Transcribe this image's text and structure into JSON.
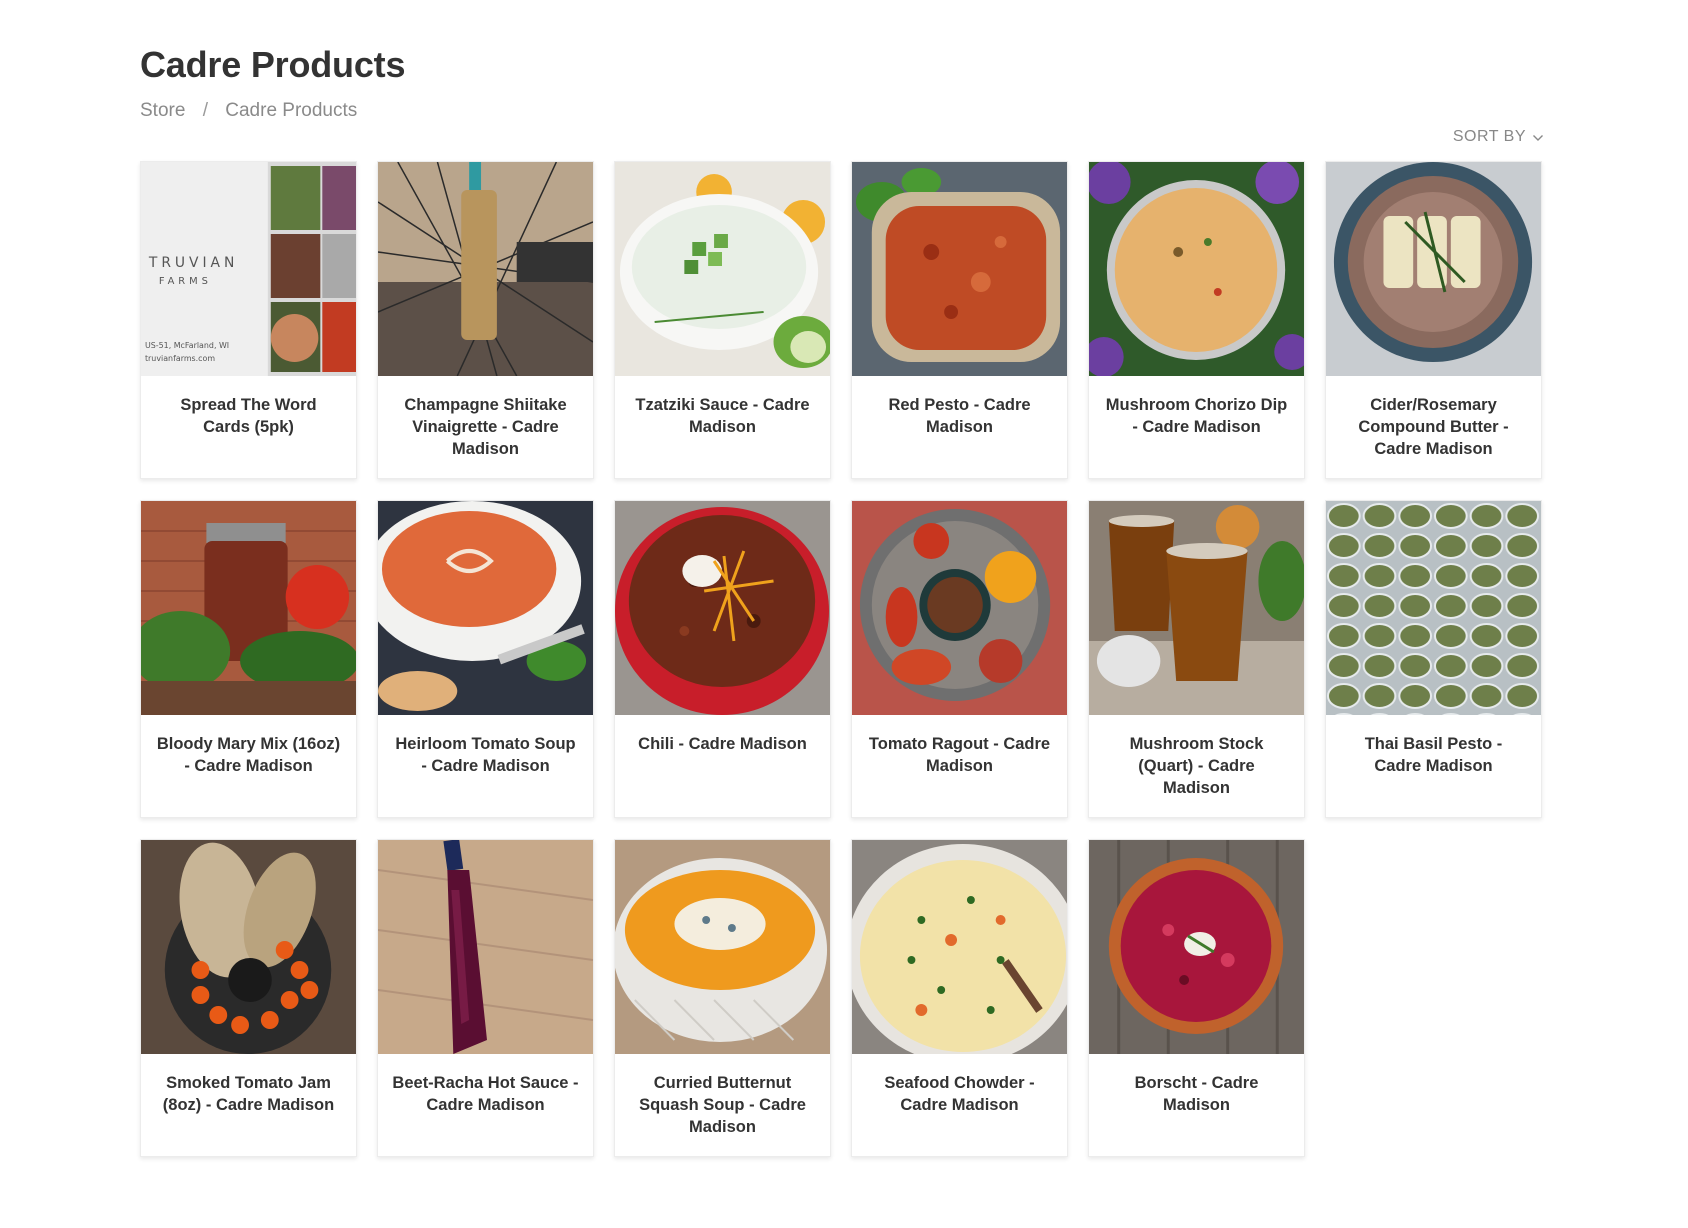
{
  "page": {
    "title": "Cadre Products",
    "breadcrumb": [
      {
        "label": "Store"
      },
      {
        "label": "Cadre Products"
      }
    ],
    "sort_label": "SORT BY"
  },
  "products": [
    {
      "name": "Spread The Word Cards (5pk)",
      "image_text": [
        "TRUVIAN",
        "FARMS",
        "US-51, McFarland, WI",
        "truvianfarms.com"
      ]
    },
    {
      "name": "Champagne Shiitake Vinaigrette - Cadre Madison"
    },
    {
      "name": "Tzatziki Sauce - Cadre Madison"
    },
    {
      "name": "Red Pesto - Cadre Madison"
    },
    {
      "name": "Mushroom Chorizo Dip - Cadre Madison"
    },
    {
      "name": "Cider/Rosemary Compound Butter - Cadre Madison"
    },
    {
      "name": "Bloody Mary Mix (16oz) - Cadre Madison"
    },
    {
      "name": "Heirloom Tomato Soup - Cadre Madison"
    },
    {
      "name": "Chili - Cadre Madison"
    },
    {
      "name": "Tomato Ragout - Cadre Madison"
    },
    {
      "name": "Mushroom Stock (Quart) - Cadre Madison"
    },
    {
      "name": "Thai Basil Pesto - Cadre Madison"
    },
    {
      "name": "Smoked Tomato Jam (8oz) - Cadre Madison"
    },
    {
      "name": "Beet-Racha Hot Sauce - Cadre Madison"
    },
    {
      "name": "Curried Butternut Squash Soup - Cadre Madison"
    },
    {
      "name": "Seafood Chowder - Cadre Madison"
    },
    {
      "name": "Borscht - Cadre Madison"
    }
  ]
}
